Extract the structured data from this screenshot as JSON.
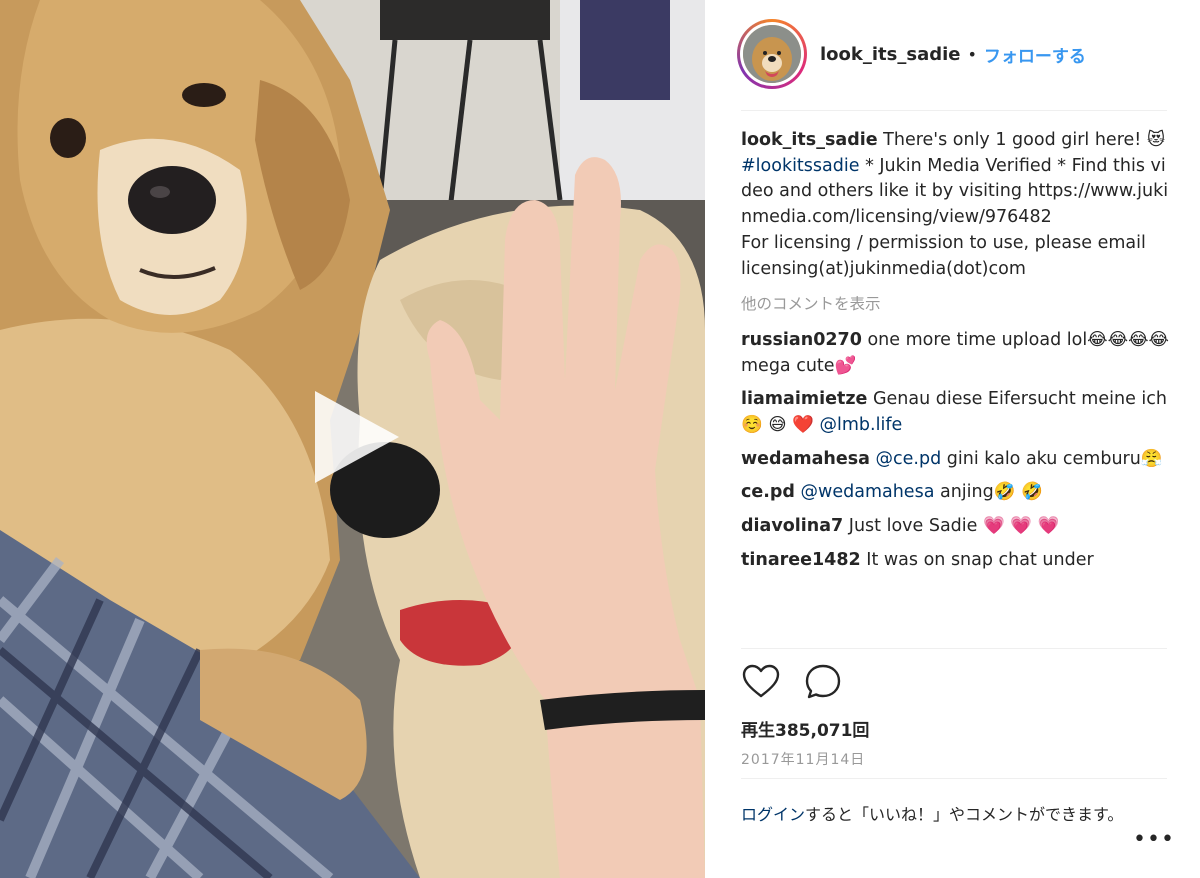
{
  "header": {
    "username": "look_its_sadie",
    "separator": "•",
    "follow_label": "フォローする"
  },
  "caption": {
    "username": "look_its_sadie",
    "text_1": " There's only 1 good girl here! 😻",
    "hashtag": "#lookitssadie",
    "text_2": " * Jukin Media Verified * Find this video and others like it by visiting https://www.jukinmedia.com/licensing/view/976482",
    "text_3": "For licensing / permission to use, please email licensing(at)jukinmedia(dot)com"
  },
  "more_comments_label": "他のコメントを表示",
  "comments": [
    {
      "username": "russian0270",
      "text": " one more time upload lol😂😂😂😂 mega cute💕"
    },
    {
      "username": "liamaimietze",
      "text": " Genau diese Eifersucht meine ich☺️ 😅 ❤️ ",
      "mention": "@lmb.life"
    },
    {
      "username": "wedamahesa",
      "mention": "@ce.pd",
      "text": " gini kalo aku cemburu😤"
    },
    {
      "username": "ce.pd",
      "mention": "@wedamahesa",
      "text": " anjing🤣 🤣"
    },
    {
      "username": "diavolina7",
      "text": " Just love Sadie 💗 💗 💗"
    },
    {
      "username": "tinaree1482",
      "text": " It was on snap chat under"
    }
  ],
  "actions": {
    "like_icon": "heart-icon",
    "comment_icon": "comment-bubble-icon"
  },
  "views_text": "再生385,071回",
  "date_text": "2017年11月14日",
  "login_prompt": {
    "link": "ログイン",
    "rest": "すると「いいね！」やコメントができます。"
  },
  "more_options": "•••",
  "colors": {
    "accent_link": "#3897f0",
    "mention_link": "#003569",
    "muted_text": "#999999",
    "divider": "#efefef"
  }
}
